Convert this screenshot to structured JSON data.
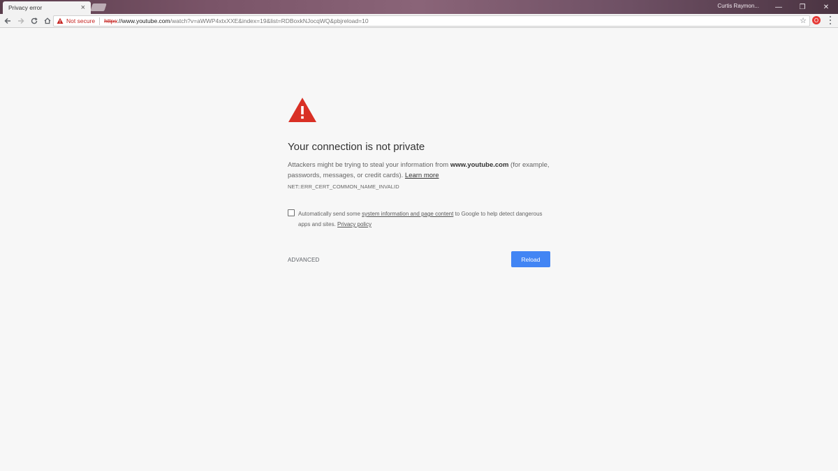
{
  "browser": {
    "tab_title": "Privacy error",
    "tab_close": "×",
    "profile_name": "Curtis Raymon...",
    "window_controls": [
      "—",
      "❐",
      "✕"
    ]
  },
  "toolbar": {
    "security_label": "Not secure",
    "url_scheme": "https",
    "url_host": "://www.youtube.com",
    "url_rest": "/watch?v=aWWP4xtxXXE&index=19&list=RDBoxkNJocqWQ&pbjreload=10",
    "bookmark_icon": "star-icon"
  },
  "interstitial": {
    "heading": "Your connection is not private",
    "explanation_prefix": "Attackers might be trying to steal your information from ",
    "explanation_domain": "www.youtube.com",
    "explanation_suffix": " (for example, passwords, messages, or credit cards). ",
    "learn_more": "Learn more",
    "error_code": "NET::ERR_CERT_COMMON_NAME_INVALID",
    "optin_prefix": "Automatically send some ",
    "optin_link": "system information and page content",
    "optin_middle": " to Google to help detect dangerous apps and sites. ",
    "privacy_policy": "Privacy policy",
    "advanced_label": "ADVANCED",
    "reload_label": "Reload"
  },
  "colors": {
    "warning_red": "#d93025",
    "reload_blue": "#4285f4",
    "background": "#f7f7f7"
  }
}
